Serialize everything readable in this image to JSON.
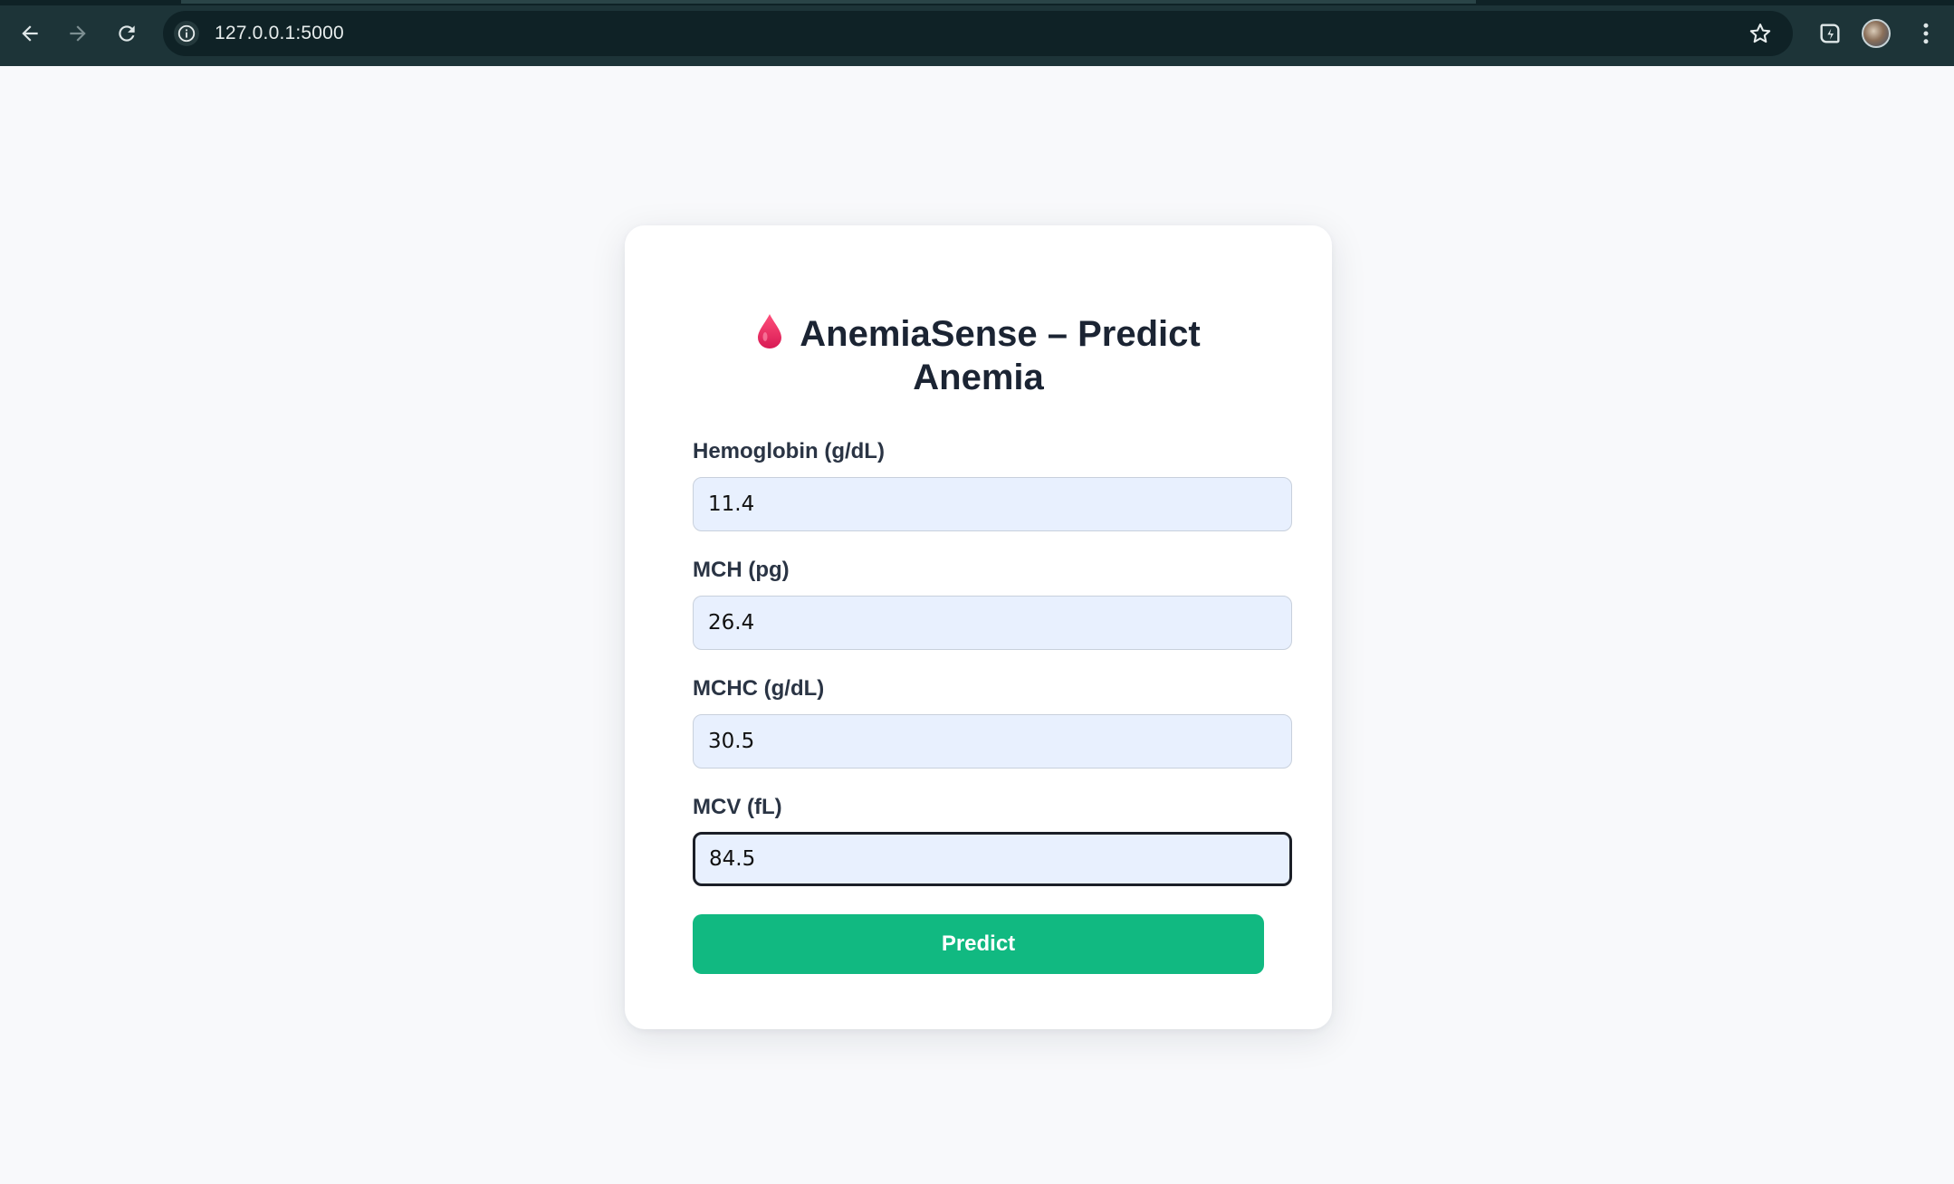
{
  "browser": {
    "url": "127.0.0.1:5000",
    "icons": {
      "back": "back-arrow-icon",
      "forward": "forward-arrow-icon",
      "reload": "reload-icon",
      "site_info": "info-icon",
      "bookmark": "star-icon",
      "extension": "extension-icon",
      "profile": "avatar",
      "menu": "kebab-menu-icon"
    }
  },
  "app": {
    "title_line1": "AnemiaSense – Predict",
    "title_line2": "Anemia",
    "title_icon": "blood-drop-icon",
    "accent_color": "#11b981",
    "drop_color": "#e8245f"
  },
  "form": {
    "fields": [
      {
        "label": "Hemoglobin (g/dL)",
        "value": "11.4"
      },
      {
        "label": "MCH (pg)",
        "value": "26.4"
      },
      {
        "label": "MCHC (g/dL)",
        "value": "30.5"
      },
      {
        "label": "MCV (fL)",
        "value": "84.5"
      }
    ],
    "submit_label": "Predict"
  }
}
